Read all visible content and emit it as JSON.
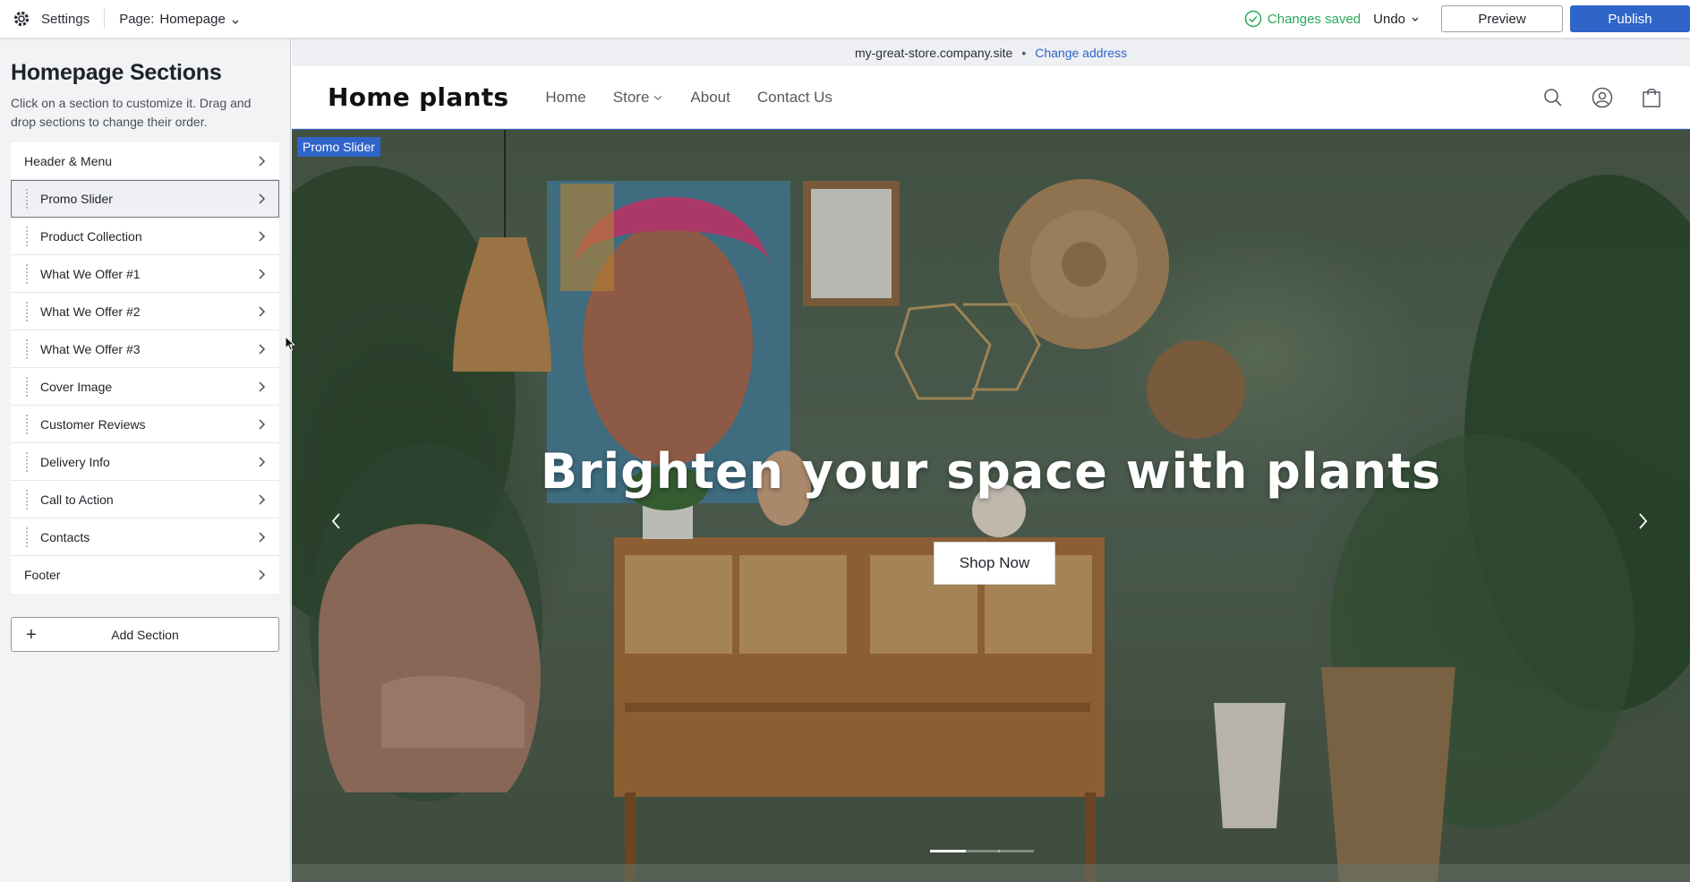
{
  "topbar": {
    "settings_label": "Settings",
    "page_label": "Page:",
    "page_value": "Homepage",
    "status_text": "Changes saved",
    "undo_label": "Undo",
    "preview_label": "Preview",
    "publish_label": "Publish"
  },
  "sidebar": {
    "title": "Homepage Sections",
    "description": "Click on a section to customize it. Drag and drop sections to change their order.",
    "sections": [
      {
        "label": "Header & Menu",
        "draggable": false
      },
      {
        "label": "Promo Slider",
        "draggable": true,
        "active": true
      },
      {
        "label": "Product Collection",
        "draggable": true
      },
      {
        "label": "What We Offer #1",
        "draggable": true
      },
      {
        "label": "What We Offer #2",
        "draggable": true
      },
      {
        "label": "What We Offer #3",
        "draggable": true
      },
      {
        "label": "Cover Image",
        "draggable": true
      },
      {
        "label": "Customer Reviews",
        "draggable": true
      },
      {
        "label": "Delivery Info",
        "draggable": true
      },
      {
        "label": "Call to Action",
        "draggable": true
      },
      {
        "label": "Contacts",
        "draggable": true
      },
      {
        "label": "Footer",
        "draggable": false
      }
    ],
    "add_section_label": "Add Section"
  },
  "preview": {
    "address": "my-great-store.company.site",
    "separator": "•",
    "change_address_label": "Change address",
    "site": {
      "logo": "Home plants",
      "nav": [
        "Home",
        "Store",
        "About",
        "Contact Us"
      ],
      "icons": [
        "search-icon",
        "account-icon",
        "cart-bag-icon"
      ]
    },
    "hero": {
      "section_tag": "Promo Slider",
      "headline": "Brighten your space with plants",
      "cta_label": "Shop Now",
      "slide_count": 3,
      "active_slide": 1
    }
  },
  "colors": {
    "accent": "#2f64c9",
    "saved_green": "#2aa85a",
    "sidebar_bg": "#f2f3f5"
  }
}
